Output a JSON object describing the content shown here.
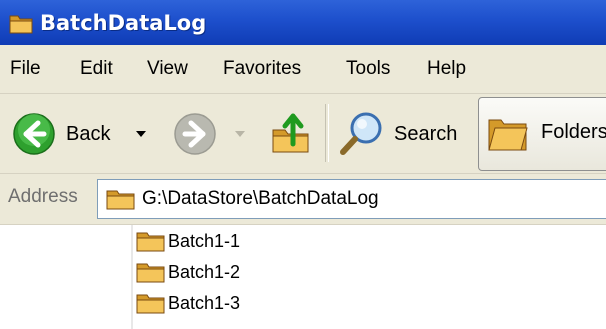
{
  "window": {
    "title": "BatchDataLog"
  },
  "menu": {
    "items": [
      {
        "label": "File"
      },
      {
        "label": "Edit"
      },
      {
        "label": "View"
      },
      {
        "label": "Favorites"
      },
      {
        "label": "Tools"
      },
      {
        "label": "Help"
      }
    ]
  },
  "toolbar": {
    "back_label": "Back",
    "search_label": "Search",
    "folders_label": "Folders"
  },
  "address": {
    "label": "Address",
    "path": "G:\\DataStore\\BatchDataLog"
  },
  "files": [
    {
      "name": "Batch1-1"
    },
    {
      "name": "Batch1-2"
    },
    {
      "name": "Batch1-3"
    }
  ],
  "colors": {
    "titlebar": "#1d4fcc",
    "chrome": "#ece9d8",
    "folder": "#f0c050"
  }
}
